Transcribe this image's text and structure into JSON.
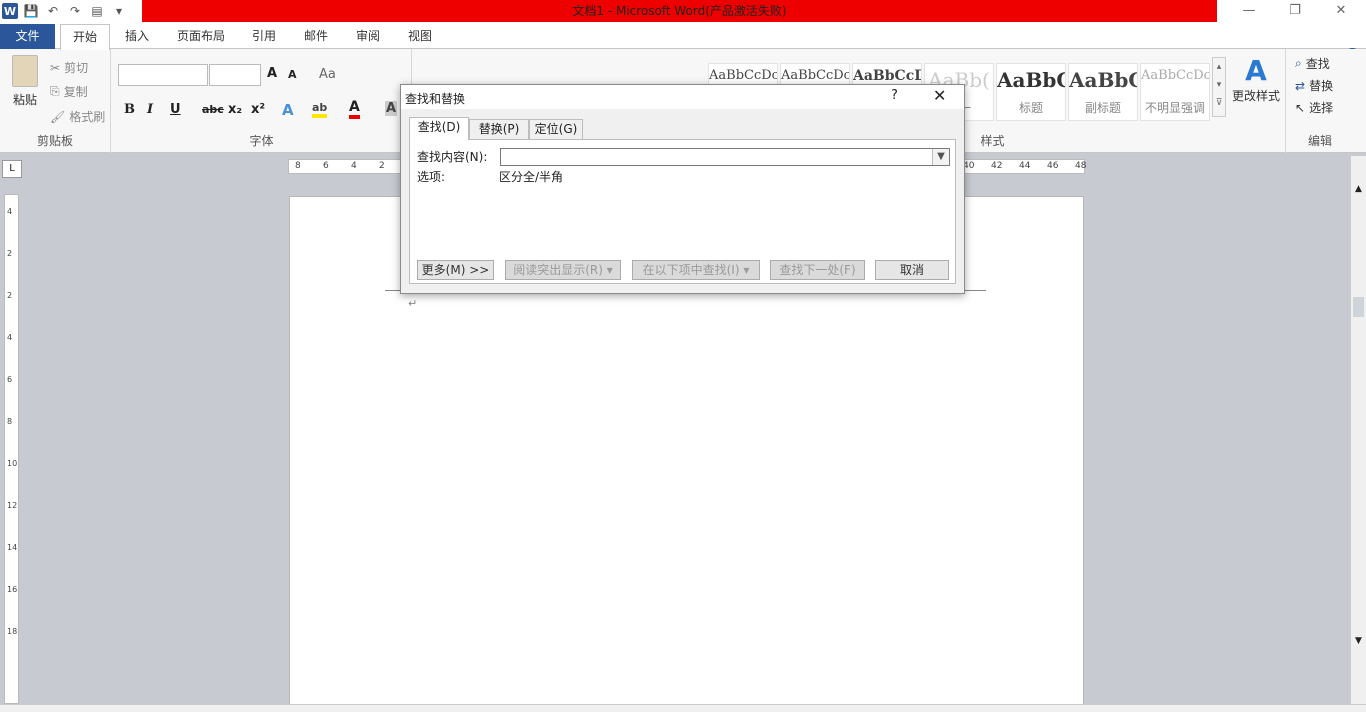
{
  "title": "文档1 - Microsoft Word(产品激活失败)",
  "qat": {
    "logo": "W",
    "icons": [
      "save-icon",
      "undo-icon",
      "redo-icon",
      "print-preview-icon",
      "customize-icon"
    ]
  },
  "window": {
    "min": "—",
    "restore": "❐",
    "close": "✕"
  },
  "tabs": {
    "file": "文件",
    "home": "开始",
    "insert": "插入",
    "layout": "页面布局",
    "references": "引用",
    "mailings": "邮件",
    "review": "审阅",
    "view": "视图"
  },
  "clipboard": {
    "paste": "粘贴",
    "cut": "剪切",
    "copy": "复制",
    "format_painter": "格式刷",
    "label": "剪贴板"
  },
  "font": {
    "label": "字体",
    "bold": "B",
    "italic": "I",
    "underline": "U",
    "strike": "abc",
    "sub": "x₂",
    "sup": "x²",
    "grow": "A",
    "shrink": "A",
    "case": "Aa"
  },
  "styles": {
    "label": "样式",
    "items": [
      {
        "preview": "AaBbCcDc",
        "name": "",
        "size": "13px",
        "bold": false,
        "color": "#444"
      },
      {
        "preview": "AaBbCcDc",
        "name": "",
        "size": "13px",
        "bold": false,
        "color": "#444"
      },
      {
        "preview": "AaBbCcD",
        "name": "",
        "size": "14px",
        "bold": true,
        "color": "#444"
      },
      {
        "preview": "AaBb(",
        "name": "式一",
        "size": "20px",
        "bold": false,
        "color": "#ccc"
      },
      {
        "preview": "AaBbC",
        "name": "标题",
        "size": "20px",
        "bold": true,
        "color": "#333"
      },
      {
        "preview": "AaBbC",
        "name": "副标题",
        "size": "20px",
        "bold": true,
        "color": "#444"
      },
      {
        "preview": "AaBbCcDc",
        "name": "不明显强调",
        "size": "13px",
        "bold": false,
        "color": "#aaa"
      }
    ],
    "change": "更改样式"
  },
  "editing": {
    "label": "编辑",
    "find": "查找",
    "replace": "替换",
    "select": "选择"
  },
  "ruler_h": [
    "8",
    "6",
    "4",
    "2",
    "40",
    "42",
    "44",
    "46",
    "48"
  ],
  "ruler_v": [
    "4",
    "2",
    "2",
    "4",
    "6",
    "8",
    "10",
    "12",
    "14",
    "16",
    "18"
  ],
  "page": {
    "para_mark": "↵"
  },
  "dialog": {
    "title": "查找和替换",
    "help": "?",
    "close": "✕",
    "tabs": [
      "查找(D)",
      "替换(P)",
      "定位(G)"
    ],
    "find_label": "查找内容(N):",
    "find_value": "",
    "options_label": "选项:",
    "options_value": "区分全/半角",
    "buttons": {
      "more": "更多(M) >>",
      "highlight": "阅读突出显示(R) ▾",
      "find_in": "在以下项中查找(I) ▾",
      "find_next": "查找下一处(F)",
      "cancel": "取消"
    }
  }
}
